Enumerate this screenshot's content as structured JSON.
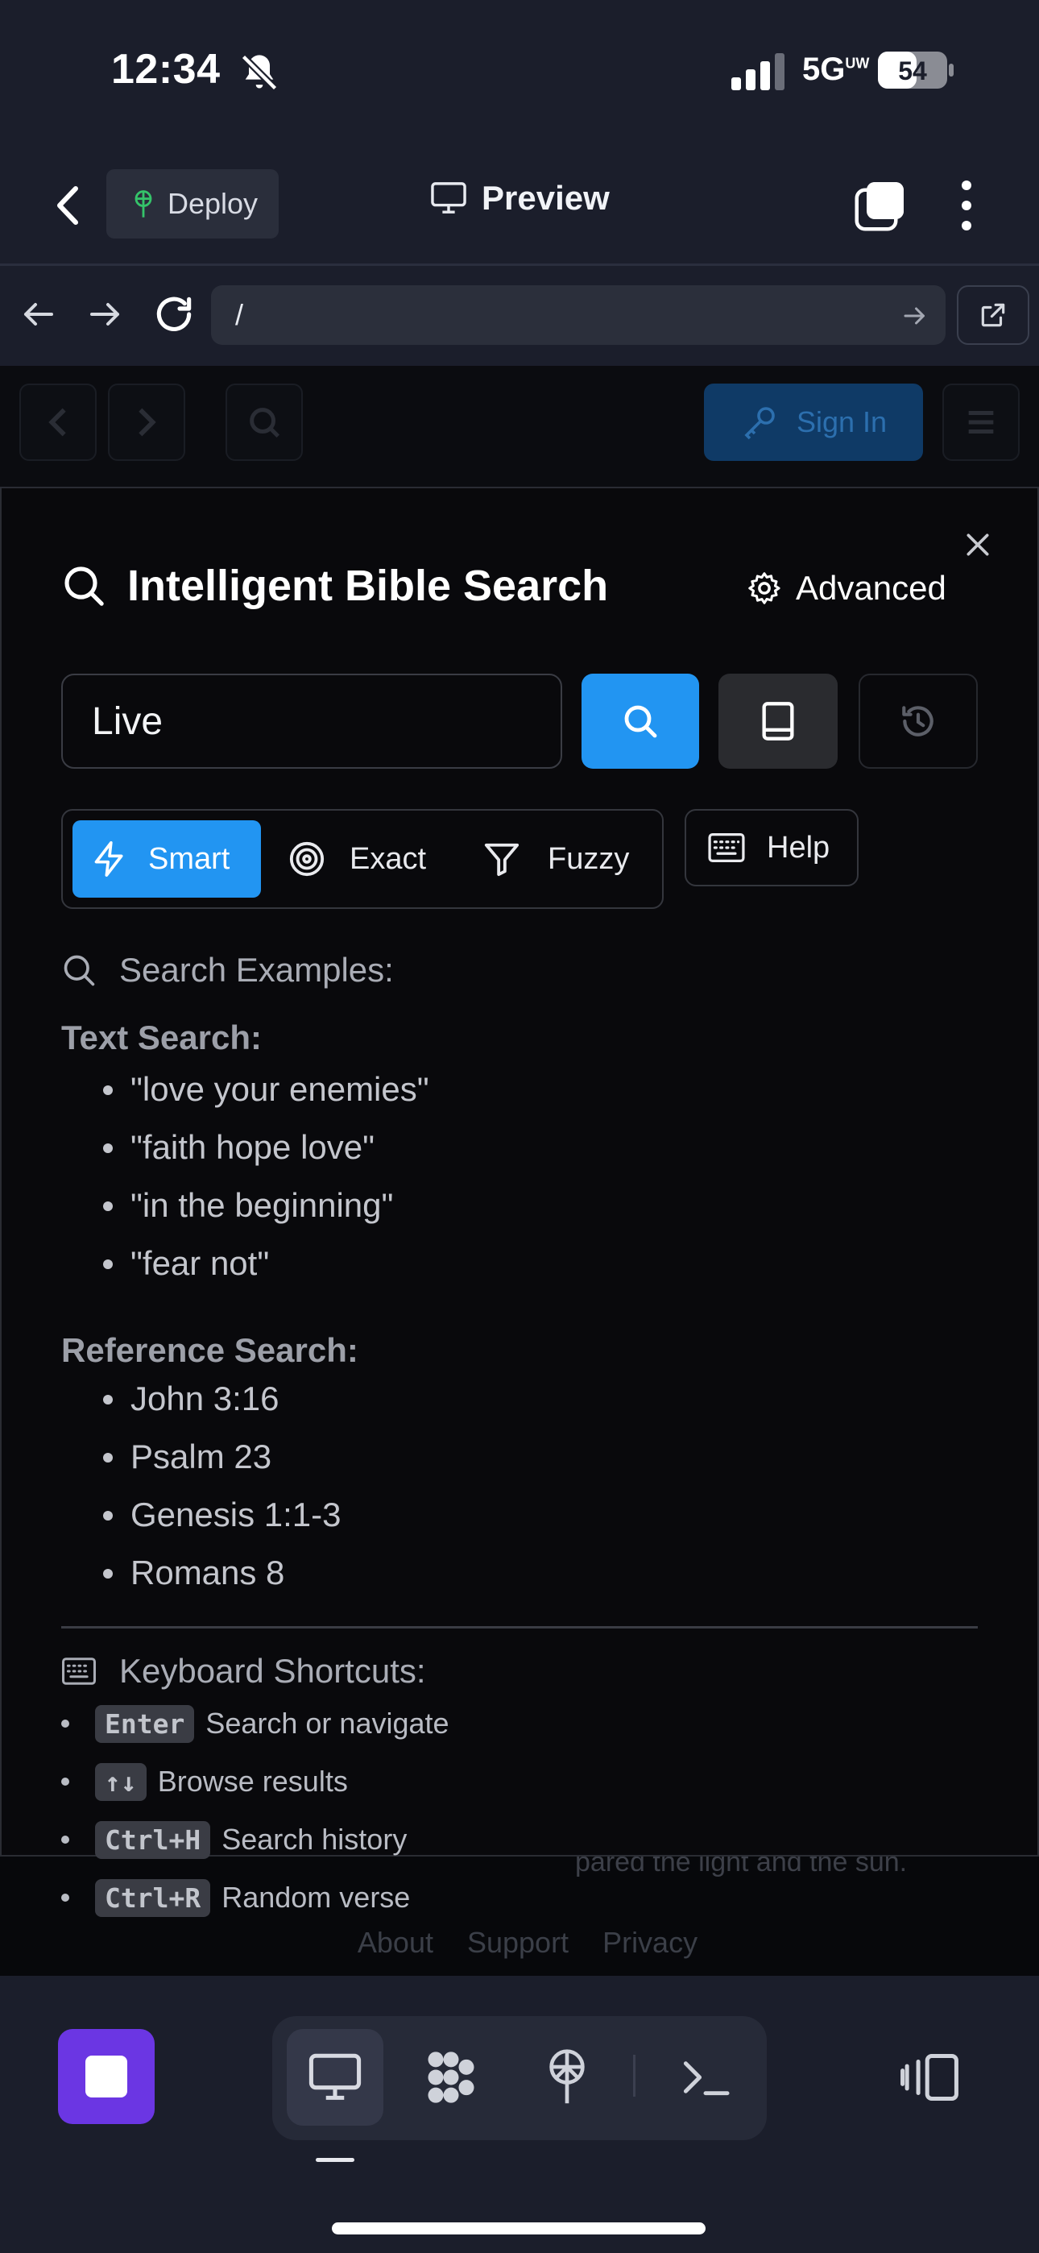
{
  "status_bar": {
    "time": "12:34",
    "network": "5G",
    "network_sup": "UW",
    "battery": "54"
  },
  "header": {
    "deploy_label": "Deploy",
    "preview_label": "Preview"
  },
  "url_bar": {
    "url": "/"
  },
  "webpage": {
    "sign_in_label": "Sign In",
    "behind_text": "pared the light and the sun.",
    "footer": {
      "about": "About",
      "support": "Support",
      "privacy": "Privacy"
    }
  },
  "modal": {
    "title": "Intelligent Bible Search",
    "advanced_label": "Advanced",
    "search_value": "Live",
    "modes": {
      "smart": "Smart",
      "exact": "Exact",
      "fuzzy": "Fuzzy",
      "active": "smart"
    },
    "help_label": "Help",
    "examples_heading": "Search Examples:",
    "text_search": {
      "label": "Text Search:",
      "items": [
        "\"love your enemies\"",
        "\"faith hope love\"",
        "\"in the beginning\"",
        "\"fear not\""
      ]
    },
    "reference_search": {
      "label": "Reference Search:",
      "items": [
        "John 3:16",
        "Psalm 23",
        "Genesis 1:1-3",
        "Romans 8"
      ]
    },
    "shortcuts_heading": "Keyboard Shortcuts:",
    "shortcuts": [
      {
        "key": "Enter",
        "desc": "Search or navigate"
      },
      {
        "key": "↑↓",
        "desc": "Browse results"
      },
      {
        "key": "Ctrl+H",
        "desc": "Search history"
      },
      {
        "key": "Ctrl+R",
        "desc": "Random verse"
      }
    ]
  },
  "colors": {
    "accent": "#2295f2",
    "stop_button": "#6b36e3",
    "app_chrome": "#1b1e2b",
    "modal_bg": "#09090c"
  }
}
